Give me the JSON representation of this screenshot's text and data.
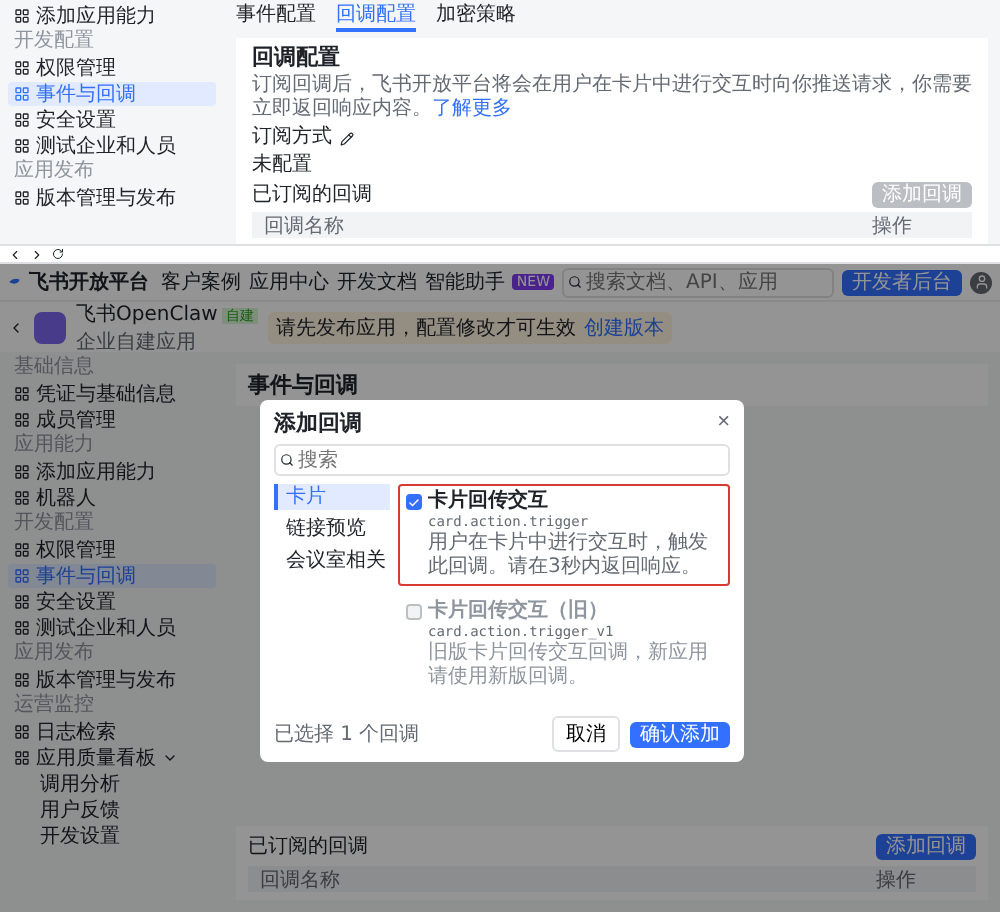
{
  "top_view": {
    "sidebar": {
      "sections": [
        {
          "items": [
            {
              "label": "添加应用能力",
              "selected": false
            }
          ]
        },
        {
          "title": "开发配置",
          "items": [
            {
              "label": "权限管理",
              "selected": false
            },
            {
              "label": "事件与回调",
              "selected": true
            },
            {
              "label": "安全设置",
              "selected": false
            },
            {
              "label": "测试企业和人员",
              "selected": false
            }
          ]
        },
        {
          "title": "应用发布",
          "items": [
            {
              "label": "版本管理与发布",
              "selected": false
            }
          ]
        }
      ]
    },
    "tabs": [
      {
        "label": "事件配置",
        "selected": false
      },
      {
        "label": "回调配置",
        "selected": true
      },
      {
        "label": "加密策略",
        "selected": false
      }
    ],
    "card": {
      "title": "回调配置",
      "description": "订阅回调后，飞书开放平台将会在用户在卡片中进行交互时向你推送请求，你需要立即返回响应内容。",
      "link": "了解更多",
      "method_label": "订阅方式",
      "method_value": "未配置",
      "subscribed_title": "已订阅的回调",
      "add_button": {
        "label": "添加回调",
        "disabled": true
      },
      "columns": [
        "回调名称",
        "操作"
      ]
    }
  },
  "bottom_view": {
    "header": {
      "logo": "飞书开放平台",
      "nav": [
        "客户案例",
        "应用中心",
        "开发文档",
        "智能助手"
      ],
      "badge": "NEW",
      "search": {
        "placeholder": "搜索文档、API、应用"
      },
      "console_button": "开发者后台"
    },
    "app": {
      "name": "飞书OpenClaw",
      "tag": "自建",
      "subtitle": "企业自建应用",
      "notice": "请先发布应用，配置修改才可生效",
      "notice_link": "创建版本"
    },
    "sidebar": {
      "sections": [
        {
          "title": "基础信息",
          "items": [
            {
              "label": "凭证与基础信息",
              "selected": false
            },
            {
              "label": "成员管理",
              "selected": false
            }
          ]
        },
        {
          "title": "应用能力",
          "items": [
            {
              "label": "添加应用能力",
              "selected": false
            },
            {
              "label": "机器人",
              "selected": false
            }
          ]
        },
        {
          "title": "开发配置",
          "items": [
            {
              "label": "权限管理",
              "selected": false
            },
            {
              "label": "事件与回调",
              "selected": true
            },
            {
              "label": "安全设置",
              "selected": false
            },
            {
              "label": "测试企业和人员",
              "selected": false
            }
          ]
        },
        {
          "title": "应用发布",
          "items": [
            {
              "label": "版本管理与发布",
              "selected": false
            }
          ]
        },
        {
          "title": "运营监控",
          "items": [
            {
              "label": "日志检索",
              "selected": false
            },
            {
              "label": "应用质量看板",
              "selected": false,
              "expanded": true,
              "children": [
                {
                  "label": "调用分析",
                  "selected": false
                },
                {
                  "label": "用户反馈",
                  "selected": false
                },
                {
                  "label": "开发设置",
                  "selected": false
                }
              ]
            }
          ]
        }
      ]
    },
    "main": {
      "title": "事件与回调",
      "subscribed_title": "已订阅的回调",
      "add_button": "添加回调",
      "columns": [
        "回调名称",
        "操作"
      ]
    },
    "dialog": {
      "title": "添加回调",
      "close": "×",
      "search": {
        "placeholder": "搜索"
      },
      "categories": [
        {
          "label": "卡片",
          "selected": true
        },
        {
          "label": "链接预览",
          "selected": false
        },
        {
          "label": "会议室相关",
          "selected": false
        }
      ],
      "options": [
        {
          "name": "卡片回传交互",
          "code": "card.action.trigger",
          "description": "用户在卡片中进行交互时，触发此回调。请在3秒内返回响应。",
          "checked": true,
          "disabled": false,
          "highlighted": true
        },
        {
          "name": "卡片回传交互（旧）",
          "code": "card.action.trigger_v1",
          "description": "旧版卡片回传交互回调，新应用请使用新版回调。",
          "checked": false,
          "disabled": true,
          "highlighted": false
        }
      ],
      "selected_count": "已选择 1 个回调",
      "cancel": "取消",
      "confirm": "确认添加"
    }
  }
}
